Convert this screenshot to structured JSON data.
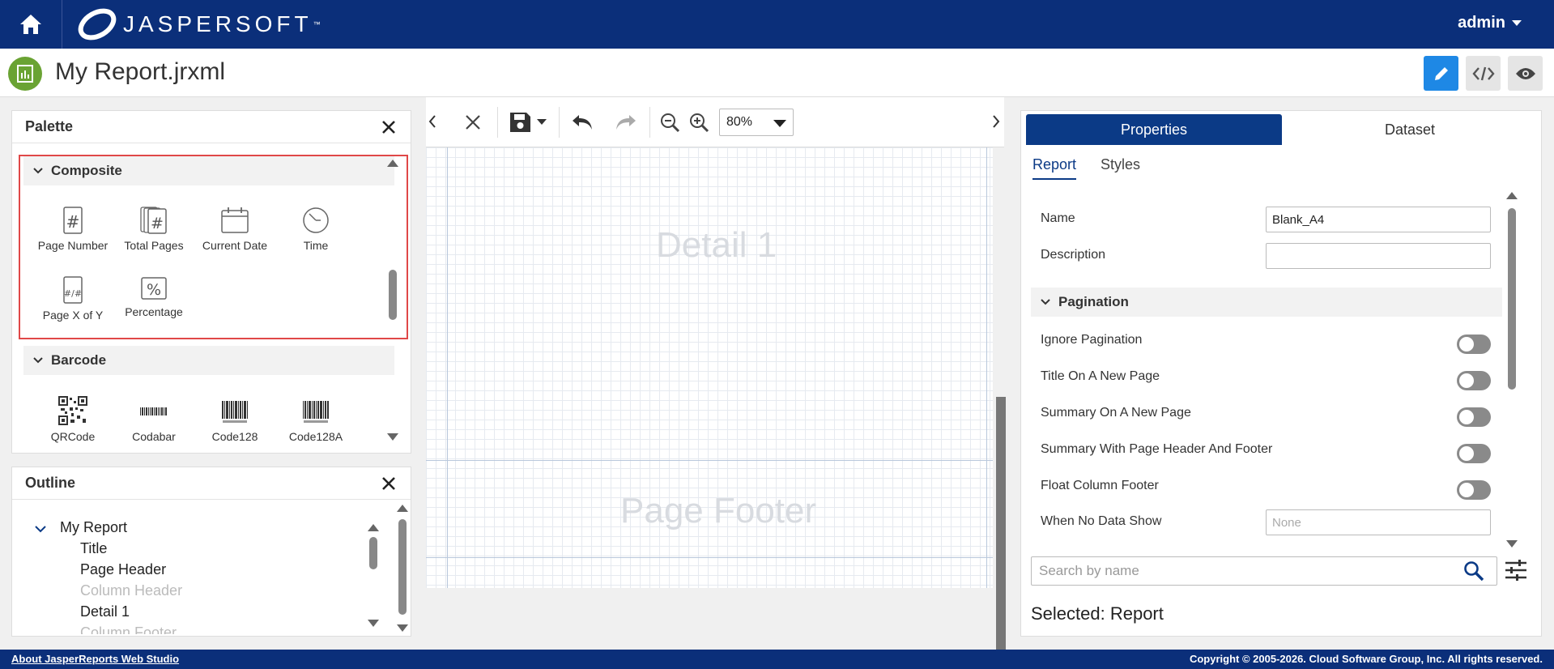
{
  "app": {
    "brand": "JASPERSOFT",
    "user": "admin"
  },
  "report": {
    "title": "My Report.jrxml"
  },
  "palette": {
    "title": "Palette",
    "sections": {
      "composite": {
        "label": "Composite",
        "items": [
          "Page Number",
          "Total Pages",
          "Current Date",
          "Time",
          "Page X of Y",
          "Percentage"
        ]
      },
      "barcode": {
        "label": "Barcode",
        "items": [
          "QRCode",
          "Codabar",
          "Code128",
          "Code128A"
        ]
      }
    }
  },
  "outline": {
    "title": "Outline",
    "root": "My Report",
    "items": [
      "Title",
      "Page Header",
      "Column Header",
      "Detail 1",
      "Column Footer"
    ]
  },
  "canvas": {
    "zoom": "80%",
    "bands": {
      "detail": "Detail 1",
      "page_footer": "Page Footer"
    }
  },
  "properties": {
    "tabs": [
      "Properties",
      "Dataset"
    ],
    "subtabs": [
      "Report",
      "Styles"
    ],
    "name_label": "Name",
    "name_value": "Blank_A4",
    "description_label": "Description",
    "description_value": "",
    "pagination_label": "Pagination",
    "toggles": [
      "Ignore Pagination",
      "Title On A New Page",
      "Summary On A New Page",
      "Summary With Page Header And Footer",
      "Float Column Footer"
    ],
    "no_data_label": "When No Data Show",
    "no_data_placeholder": "None",
    "search_placeholder": "Search by name",
    "selected": "Selected: Report"
  },
  "footer": {
    "left": "About JasperReports Web Studio",
    "right": "Copyright © 2005-2026. Cloud Software Group, Inc. All rights reserved."
  },
  "colors": {
    "header_bg": "#0b2f7a",
    "active_tab": "#0b3a86",
    "highlight": "#e04848",
    "report_icon": "#6aa333",
    "design_button": "#1e88e5"
  }
}
